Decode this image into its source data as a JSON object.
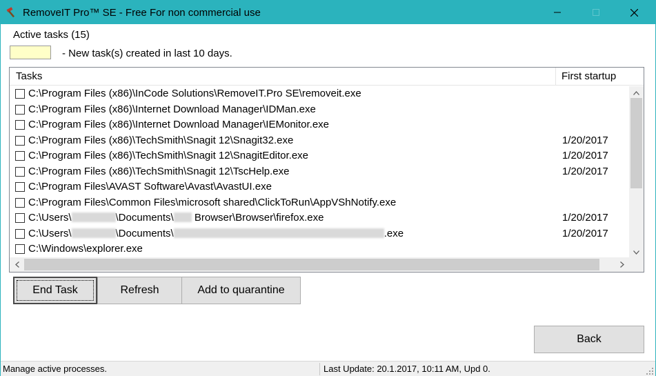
{
  "window": {
    "title": "RemoveIT Pro™ SE - Free For non commercial use",
    "app_icon": "hammer-icon",
    "controls": [
      "minimize-icon",
      "maximize-icon",
      "close-icon"
    ]
  },
  "info": {
    "active_tasks": "Active tasks (15)",
    "legend_text": "- New task(s) created in last 10 days.",
    "legend_color": "#ffffc8"
  },
  "list": {
    "columns": [
      "Tasks",
      "First startup"
    ],
    "rows": [
      {
        "path": "C:\\Program Files (x86)\\InCode Solutions\\RemoveIT.Pro SE\\removeit.exe",
        "date": ""
      },
      {
        "path": "C:\\Program Files (x86)\\Internet Download Manager\\IDMan.exe",
        "date": ""
      },
      {
        "path": "C:\\Program Files (x86)\\Internet Download Manager\\IEMonitor.exe",
        "date": ""
      },
      {
        "path": "C:\\Program Files (x86)\\TechSmith\\Snagit 12\\Snagit32.exe",
        "date": "1/20/2017"
      },
      {
        "path": "C:\\Program Files (x86)\\TechSmith\\Snagit 12\\SnagitEditor.exe",
        "date": "1/20/2017"
      },
      {
        "path": "C:\\Program Files (x86)\\TechSmith\\Snagit 12\\TscHelp.exe",
        "date": "1/20/2017"
      },
      {
        "path": "C:\\Program Files\\AVAST Software\\Avast\\AvastUI.exe",
        "date": ""
      },
      {
        "path": "C:\\Program Files\\Common Files\\microsoft shared\\ClickToRun\\AppVShNotify.exe",
        "date": ""
      },
      {
        "path_parts": [
          "C:\\Users\\",
          "\\Documents\\",
          " Browser\\Browser\\firefox.exe"
        ],
        "date": "1/20/2017"
      },
      {
        "path_parts": [
          "C:\\Users\\",
          "\\Documents\\",
          ".exe"
        ],
        "date": "1/20/2017"
      },
      {
        "path": "C:\\Windows\\explorer.exe",
        "date": ""
      }
    ]
  },
  "buttons": {
    "end_task": "End Task",
    "refresh": "Refresh",
    "quarantine": "Add to quarantine",
    "back": "Back"
  },
  "status": {
    "left": "Manage active processes.",
    "right": "Last Update: 20.1.2017, 10:11 AM, Upd 0."
  },
  "colors": {
    "titlebar": "#2bb3bd",
    "button_face": "#e1e1e1"
  }
}
